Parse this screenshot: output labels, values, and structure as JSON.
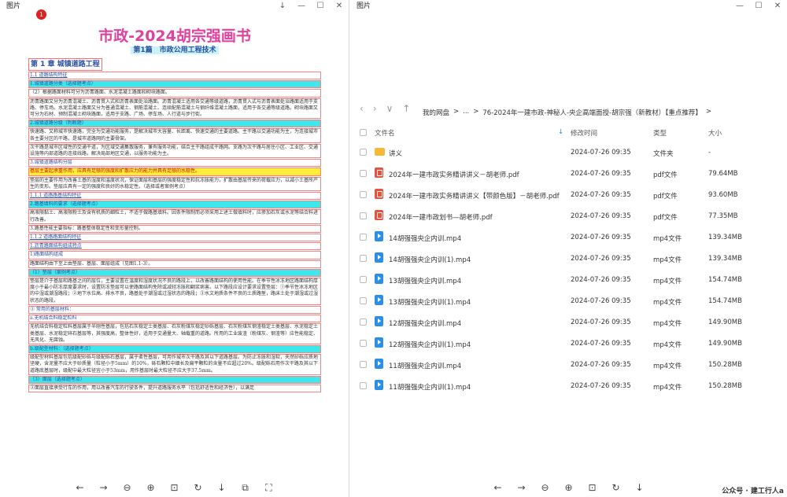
{
  "left_window": {
    "title": "图片",
    "controls": [
      "↓",
      "—",
      "☐",
      "✕"
    ],
    "badge": "1",
    "doc": {
      "title": "市政-2024胡宗强画书",
      "subtitle": "第1篇　市政公用工程技术",
      "chapter": "第 1 章  城镇道路工程",
      "lines": [
        {
          "t": "1.1  道路结构特征",
          "cls": "blue lnk"
        },
        {
          "t": "1.城镇道路分类（选择题考点）",
          "cls": "blue",
          "hl": "c"
        },
        {
          "t": "（2）根据路面材料可分为沥青路面、水泥混凝土路面和砌块路面。",
          "cls": ""
        },
        {
          "t": "沥青路面又分为沥青混凝土、沥青贯入式和沥青表面处治路面。沥青混凝土适用各交通等级道路，沥青贯入式与沥青表面处治路面适用于支路、停车场。水泥混凝土路面又分为普通混凝土、钢筋混凝土、连续配筋混凝土与钢纤维混凝土路面，适用于各交通等级道路。砌块路面又可分为石材、预制混凝土砌块路面，适用于支路、广场、停车场、人行道与步行街。",
          "cls": ""
        },
        {
          "t": "2.城镇道路分级（判断题）",
          "cls": "blue",
          "hl": "c"
        },
        {
          "t": "快速路、又称城市快速路，完全为交通功能服务，是解决城市大容量、长距离、快速交通的主要道路。主干路以交通功能为主，为连接城市各主要分区的干路，是城市道路网的主要骨架。",
          "cls": ""
        },
        {
          "t": "次干路是城市区域性的交通干道，为区域交通集散服务，兼有服务功能，结合主干路组成干路网。支路为次干路与居住小区、工业区、交通设施等内部道路的连接线路，解决局部地区交通，以服务功能为主。",
          "cls": ""
        },
        {
          "t": "3.城镇道路结构分层",
          "cls": "blue"
        },
        {
          "t": "基层主要起承重作用，应具有足够的强度和扩散应力的能力并具有足够的水稳性。",
          "cls": "red",
          "hl": "y"
        },
        {
          "t": "垫层的主要作用为改善土基的湿度和温度状况，保证面层和基层的强度稳定性和抗冻胀能力，扩散由基层传来的荷载应力，以减小土基所产生的变形。垫层应具有一定的强度和良好的水稳定性。（选择或者案例考点）",
          "cls": ""
        },
        {
          "t": "1.1.1  道路路基结构特征",
          "cls": "blue lnk"
        },
        {
          "t": "2.路基填料的要求（选择题考点）",
          "cls": "blue",
          "hl": "c"
        },
        {
          "t": "高液限黏土、高液限粉土及含有机质的细粒土，不适于做路基填料。因条件限制而必须采用上述土做填料时，应掺加石灰或水泥等结合料进行改善。",
          "cls": ""
        },
        {
          "t": "3.路基性能主要指标：路基整体稳定性和变形量控制。",
          "cls": ""
        },
        {
          "t": "1.1.2  道路路面结构特征",
          "cls": "blue lnk"
        },
        {
          "t": "1.沥青路面结构组成特点",
          "cls": "blue lnk"
        },
        {
          "t": "1)路面结构组成",
          "cls": "blue"
        },
        {
          "t": "路面结构由下至上由垫层、基层、面层组成（见图1.1-3）。",
          "cls": ""
        },
        {
          "t": "（1）垫层（案例考点）",
          "cls": "blue",
          "hl": "c"
        },
        {
          "t": "垫层是介于基层和路基之间的层位，主要设置在温度和湿度状况不良的路段上，以改善路面结构的使用性能。在季节性冰冻地区路面结构厚度小于最小防冻厚度要求时，设置防冻垫层可以使路面结构免除或减轻冻胀和翻浆病害。以下路段应设计要求设置垫层：①季节性冰冻地区的中湿或潮湿路段；②地下水位高、排水不良，路基处于潮湿或过湿状态的路段；③水文地质条件不良的土质路堑，路床土处于潮湿或过湿状态的路段。",
          "cls": ""
        },
        {
          "t": "③ 常用的基层材料：",
          "cls": "blue"
        },
        {
          "t": "a.无机结合料稳定粒料",
          "cls": "blue"
        },
        {
          "t": "无机结合料稳定粒料基层属于半刚性基层，包括石灰稳定土类基层、石灰粉煤灰稳定砂砾基层、石灰粉煤灰钢渣稳定土类基层、水泥稳定土类基层、水泥稳定碎石基层等，其强度高，整体性好，适用于交通量大、轴载重的道路。所用的工业废渣（粉煤灰、钢渣等）应性能稳定、无风化、无腐蚀。",
          "cls": ""
        },
        {
          "t": "b.级配型材料：（选择题考点）",
          "cls": "blue",
          "hl": "c"
        },
        {
          "t": "级配型材料基层包括级配砂砾与级配砾石基层，属于柔性基层，可用作城市次干路及其以下道路基层。为防止冻胀和湿软，天然砂砾应质地坚硬，含泥量不应大于砂质量（粒径小于5mm）的10%，砾石颗粒中细长及扁平颗粒的含量不应超过20%。级配砾石用作次干路及其以下道路底基层时，级配中最大粒径宜小于53mm，用作基层时最大粒径不应大于37.5mm。",
          "cls": ""
        },
        {
          "t": "（3）面层（选择题考点）",
          "cls": "blue",
          "hl": "c"
        },
        {
          "t": "②面层直接承受行车的作用，用以改善汽车的行驶条件，提升道路服务水平（包括舒适性和经济性），以满足",
          "cls": ""
        }
      ]
    },
    "toolbar": [
      "←",
      "→",
      "⊖",
      "⊕",
      "⊡",
      "↻",
      "↓",
      "⧉",
      "⛶"
    ]
  },
  "right_window": {
    "title": "图片",
    "controls": [
      "—",
      "☐",
      "✕"
    ],
    "nav": [
      "‹",
      "›",
      "∨",
      "↑"
    ],
    "breadcrumbs": [
      "我的网盘",
      ">",
      "...",
      ">",
      "76-2024年一建市政-神秘人-央企高端面授-胡宗强（新教材）【重点推荐】",
      ">"
    ],
    "headers": {
      "name": "文件名",
      "time": "修改时间",
      "type": "类型",
      "size": "大小"
    },
    "files": [
      {
        "icon": "folder",
        "name": "讲义",
        "time": "2024-07-26 09:35",
        "type": "文件夹",
        "size": "-"
      },
      {
        "icon": "pdf",
        "name": "2024年一建市政实务精讲讲义－胡老师.pdf",
        "time": "2024-07-26 09:35",
        "type": "pdf文件",
        "size": "79.64MB"
      },
      {
        "icon": "pdf",
        "name": "2024年一建市政实务精讲讲义【带颜色版】－胡老师.pdf",
        "time": "2024-07-26 09:35",
        "type": "pdf文件",
        "size": "93.60MB"
      },
      {
        "icon": "pdf",
        "name": "2024年一建市政划书—胡老师.pdf",
        "time": "2024-07-26 09:35",
        "type": "pdf文件",
        "size": "77.35MB"
      },
      {
        "icon": "mp4",
        "name": "14胡强强央企内训.mp4",
        "time": "2024-07-26 09:35",
        "type": "mp4文件",
        "size": "139.34MB"
      },
      {
        "icon": "mp4",
        "name": "14胡强强央企内训(1).mp4",
        "time": "2024-07-26 09:35",
        "type": "mp4文件",
        "size": "139.34MB"
      },
      {
        "icon": "mp4",
        "name": "13胡强强央企内训.mp4",
        "time": "2024-07-26 09:35",
        "type": "mp4文件",
        "size": "154.74MB"
      },
      {
        "icon": "mp4",
        "name": "13胡强强央企内训(1).mp4",
        "time": "2024-07-26 09:35",
        "type": "mp4文件",
        "size": "154.74MB"
      },
      {
        "icon": "mp4",
        "name": "12胡强强央企内训.mp4",
        "time": "2024-07-26 09:35",
        "type": "mp4文件",
        "size": "149.90MB"
      },
      {
        "icon": "mp4",
        "name": "12胡强强央企内训(1).mp4",
        "time": "2024-07-26 09:35",
        "type": "mp4文件",
        "size": "149.90MB"
      },
      {
        "icon": "mp4",
        "name": "11胡强强央企内训.mp4",
        "time": "2024-07-26 09:35",
        "type": "mp4文件",
        "size": "150.28MB"
      },
      {
        "icon": "mp4",
        "name": "11胡强强央企内训(1).mp4",
        "time": "2024-07-26 09:35",
        "type": "mp4文件",
        "size": "150.28MB"
      }
    ],
    "toolbar": [
      "←",
      "→",
      "⊖",
      "⊕",
      "⊡",
      "↻",
      "↓"
    ],
    "watermark": "公众号 · 建工行人a"
  }
}
